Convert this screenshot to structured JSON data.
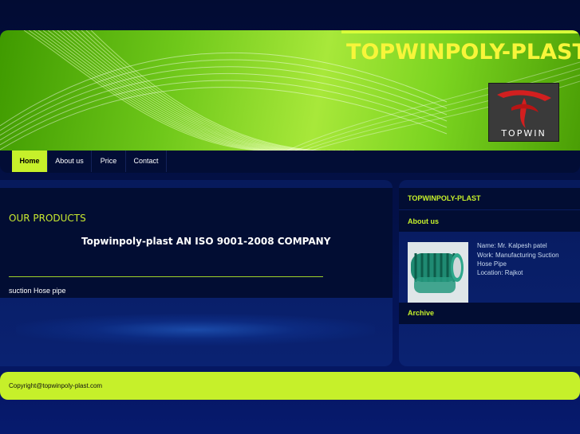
{
  "header": {
    "site_title": "TOPWINPOLY-PLAST",
    "logo_text": "TOPWIN"
  },
  "nav": {
    "items": [
      {
        "label": "Home",
        "active": true
      },
      {
        "label": "About us",
        "active": false
      },
      {
        "label": "Price",
        "active": false
      },
      {
        "label": "Contact",
        "active": false
      }
    ]
  },
  "main": {
    "products_title": "OUR PRODUCTS",
    "company_line": "Topwinpoly-plast AN ISO 9001-2008 COMPANY",
    "product_text": "suction Hose pipe"
  },
  "sidebar": {
    "heading": "TOPWINPOLY-PLAST",
    "about_label": "About us",
    "info": {
      "name": "Name: Mr. Kalpesh patel",
      "work_1": "Work: Manufacturing Suction",
      "work_2": "Hose Pipe",
      "location": "Location: Rajkot"
    },
    "archive_label": "Archive"
  },
  "footer": {
    "copyright": "Copyright@topwinpoly-plast.com"
  },
  "colors": {
    "accent": "#c6f02a",
    "title_yellow": "#f7f53a",
    "background": "#020c33"
  }
}
